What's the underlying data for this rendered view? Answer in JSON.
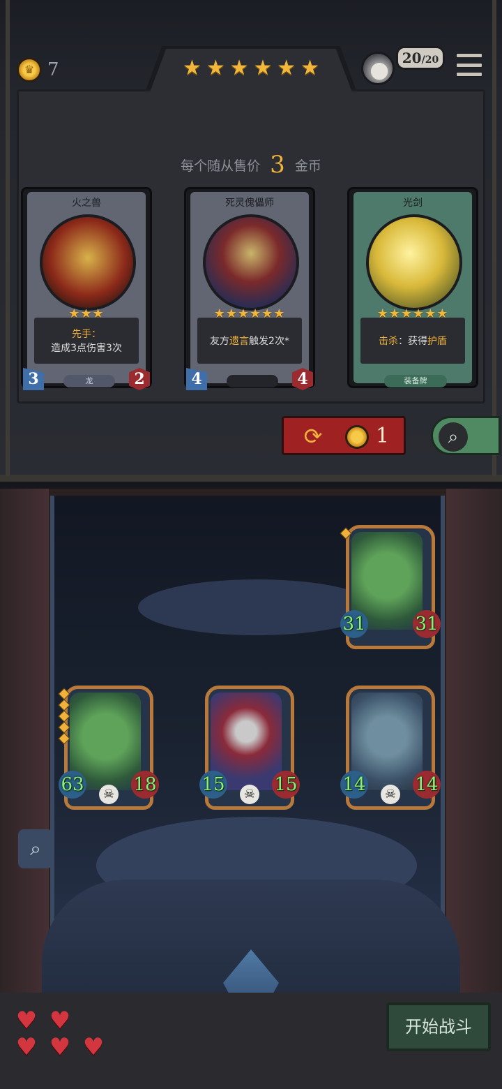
{
  "header": {
    "gold": "7",
    "tier_stars": 6,
    "hp_current": "20",
    "hp_max": "20"
  },
  "shop": {
    "price_prefix": "每个随从售价",
    "price_value": "3",
    "price_suffix": "金币",
    "cards": [
      {
        "name": "火之兽",
        "stars": "★★★",
        "desc_highlight": "先手：",
        "desc_text": "造成3点伤害3次",
        "attack": "3",
        "health": "2",
        "tag": "龙"
      },
      {
        "name": "死灵傀儡师",
        "stars": "★★★★★★",
        "desc_prefix": "友方",
        "desc_highlight": "遗言",
        "desc_suffix": "触发2次*",
        "attack": "4",
        "health": "4",
        "tag": ""
      },
      {
        "name": "光剑",
        "stars": "★★★★★★",
        "desc_highlight": "击杀",
        "desc_text": "：获得",
        "desc_highlight2": "护盾",
        "tag": "装备牌"
      }
    ],
    "refresh_cost": "1"
  },
  "board": {
    "units": [
      {
        "name": "dragon-top",
        "attack": "31",
        "health": "31",
        "pips": 1
      },
      {
        "name": "dragon-left",
        "attack": "63",
        "health": "18",
        "pips": 5
      },
      {
        "name": "clown-center",
        "attack": "15",
        "health": "15",
        "pips": 0
      },
      {
        "name": "beast-right",
        "attack": "14",
        "health": "14",
        "pips": 0
      }
    ],
    "lives_remaining": 5,
    "start_label": "开始战斗"
  }
}
